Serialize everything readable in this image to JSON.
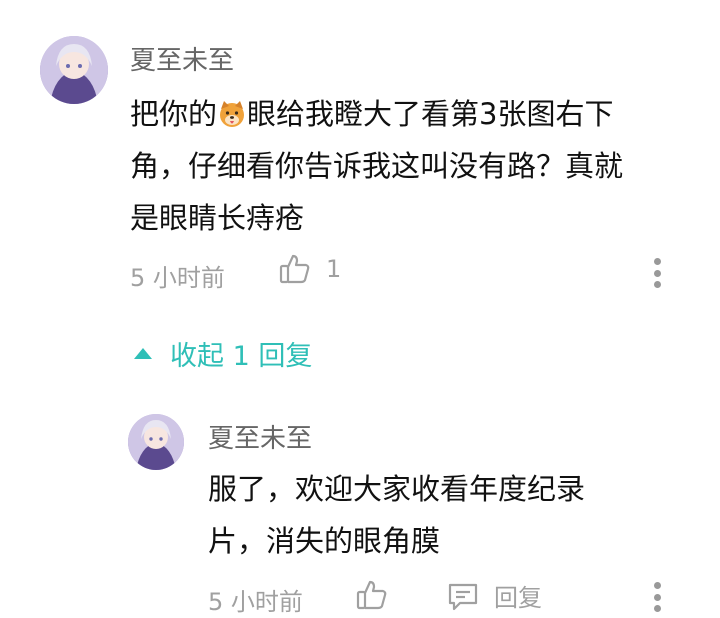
{
  "comment": {
    "username": "夏至未至",
    "text_part1": "把你的",
    "emoji": "dog-face-emoji",
    "text_part2": "眼给我瞪大了看第3张图右下\n角，仔细看你告诉我这叫没有路？真就\n是眼睛长痔疮",
    "time": "5 小时前",
    "like_count": "1"
  },
  "collapse": {
    "label": "收起 1 回复"
  },
  "reply": {
    "username": "夏至未至",
    "text": "服了，欢迎大家收看年度纪录\n片，消失的眼角膜",
    "time": "5 小时前",
    "reply_label": "回复"
  },
  "colors": {
    "accent": "#2fbfb7",
    "meta_gray": "#a0a0a0"
  }
}
